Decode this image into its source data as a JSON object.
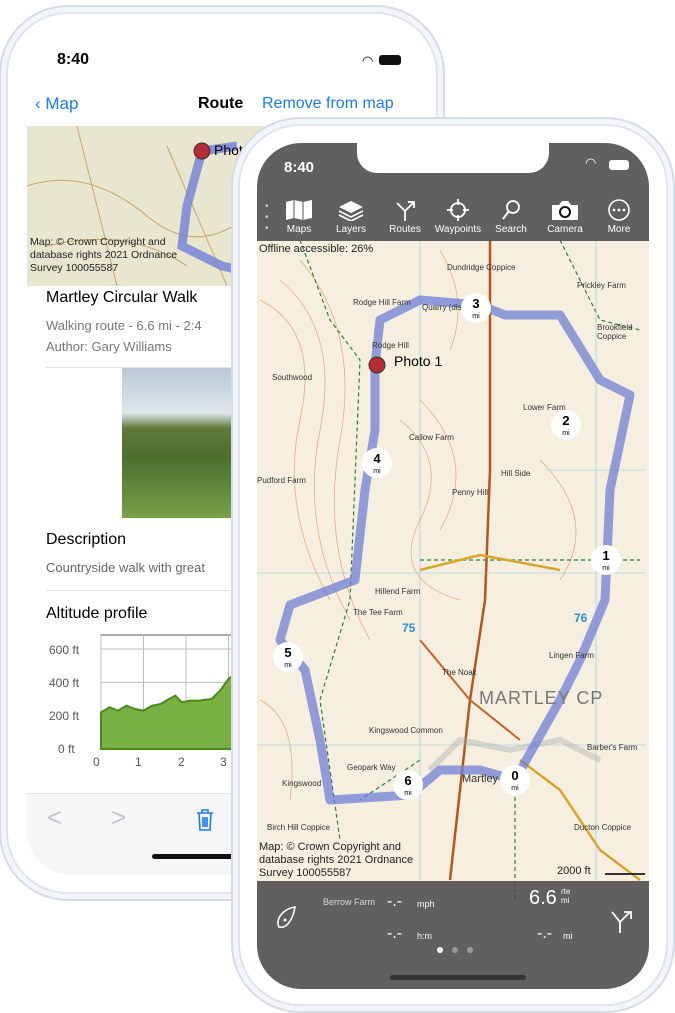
{
  "back_phone": {
    "status": {
      "time": "8:40"
    },
    "nav": {
      "back_label": "Map",
      "title": "Route",
      "action": "Remove from map"
    },
    "map_credit": "Map: © Crown Copyright and database rights 2021 Ordnance Survey 100055587",
    "photo_label": "Photo 1",
    "route": {
      "name": "Martley Circular Walk",
      "summary": "Walking route - 6.6 mi - 2:4",
      "author": "Author: Gary Williams"
    },
    "description": {
      "heading": "Description",
      "text": "Countryside walk with great"
    },
    "altitude": {
      "heading": "Altitude profile",
      "y_ticks": [
        "600 ft",
        "400 ft",
        "200 ft",
        "0 ft"
      ],
      "x_ticks": [
        "0",
        "1",
        "2",
        "3"
      ],
      "profile_ft": {
        "x_mi": [
          0,
          0.2,
          0.4,
          0.6,
          0.8,
          1.0,
          1.2,
          1.4,
          1.6,
          1.75,
          1.9,
          2.1,
          2.3,
          2.6,
          2.8,
          3.0,
          3.1,
          3.2,
          3.3
        ],
        "y_ft": [
          220,
          250,
          230,
          260,
          240,
          230,
          260,
          270,
          300,
          320,
          280,
          290,
          290,
          300,
          350,
          420,
          440,
          520,
          560
        ]
      },
      "color": "#79b043"
    },
    "toolbar": {
      "prev": "<",
      "next": ">",
      "delete_icon": "trash-icon"
    }
  },
  "front_phone": {
    "status": {
      "time": "8:40"
    },
    "toolbar": [
      {
        "label": "Maps",
        "icon": "map-icon"
      },
      {
        "label": "Layers",
        "icon": "layers-icon"
      },
      {
        "label": "Routes",
        "icon": "routes-icon"
      },
      {
        "label": "Waypoints",
        "icon": "crosshair-icon"
      },
      {
        "label": "Search",
        "icon": "search-icon"
      },
      {
        "label": "Camera",
        "icon": "camera-icon"
      },
      {
        "label": "More",
        "icon": "more-icon"
      }
    ],
    "offline": "Offline accessible: 26%",
    "photo_label": "Photo 1",
    "markers": [
      {
        "n": "0",
        "u": "mi"
      },
      {
        "n": "1",
        "u": "mi"
      },
      {
        "n": "2",
        "u": "mi"
      },
      {
        "n": "3",
        "u": "mi"
      },
      {
        "n": "4",
        "u": "mi"
      },
      {
        "n": "5",
        "u": "mi"
      },
      {
        "n": "6",
        "u": "mi"
      }
    ],
    "map_labels": {
      "parish": "MARTLEY CP",
      "grid_75": "75",
      "grid_76": "76",
      "places": [
        "Rodge Hill Farm",
        "Rodge Hill",
        "Southwood",
        "Pudford Farm",
        "Callow Farm",
        "Hill Side",
        "Lower Farm",
        "Prickley Farm",
        "Brookfield Coppice",
        "Lingen Farm",
        "The Tee Farm",
        "Hillend Farm",
        "Kingswood Common",
        "Kingswood",
        "Martley",
        "Geopark Way",
        "Barber's Farm",
        "Ducton Coppice",
        "Dundridge Coppice",
        "Quarry (dis)",
        "Penny Hill",
        "Berrow Farm",
        "Birch Hill Coppice",
        "The Noak"
      ]
    },
    "map_credit": "Map: © Crown Copyright and database rights 2021 Ordnance Survey 100055587",
    "scale": "2000 ft",
    "stats": {
      "speed": "-.-",
      "speed_unit": "mph",
      "time": "-.-",
      "time_unit": "h:m",
      "route_dist": "6.6",
      "route_unit_top": "rte",
      "route_unit": "mi",
      "dist": "-.-",
      "dist_unit": "mi"
    },
    "route_color": "#6f7fd6"
  }
}
